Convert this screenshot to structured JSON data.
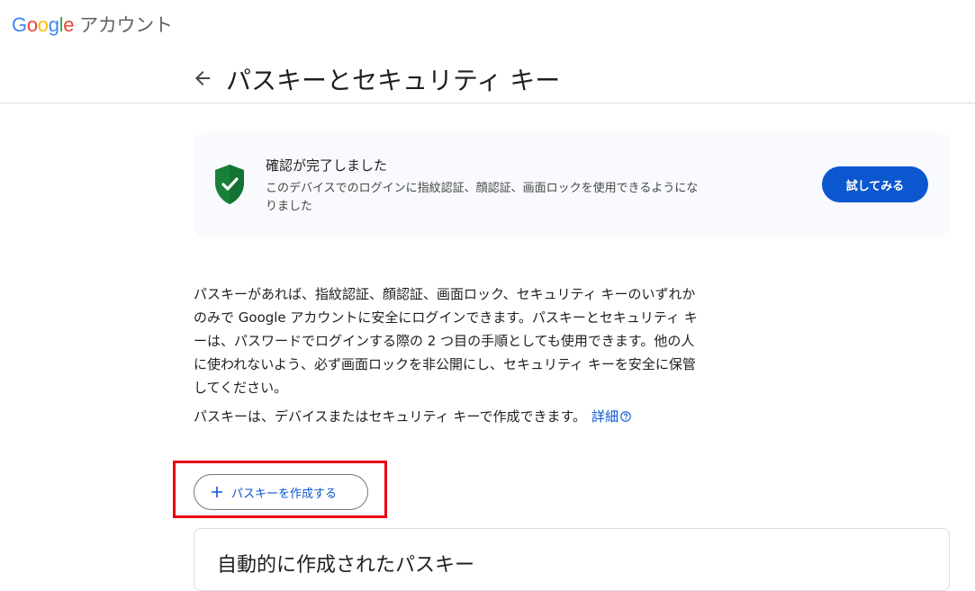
{
  "brand": {
    "logo_letters": [
      "G",
      "o",
      "o",
      "g",
      "l",
      "e"
    ],
    "product": "アカウント"
  },
  "header": {
    "title": "パスキーとセキュリティ キー"
  },
  "banner": {
    "title": "確認が完了しました",
    "description": "このデバイスでのログインに指紋認証、顔認証、画面ロックを使用できるようになりました",
    "button_label": "試してみる"
  },
  "body": {
    "paragraph1": "パスキーがあれば、指紋認証、顔認証、画面ロック、セキュリティ キーのいずれかのみで Google アカウントに安全にログインできます。パスキーとセキュリティ キーは、パスワードでログインする際の 2 つ目の手順としても使用できます。他の人に使われないよう、必ず画面ロックを非公開にし、セキュリティ キーを安全に保管してください。",
    "paragraph2": "パスキーは、デバイスまたはセキュリティ キーで作成できます。",
    "detail_link": "詳細"
  },
  "create_button": {
    "label": "パスキーを作成する"
  },
  "auto_section": {
    "title": "自動的に作成されたパスキー"
  },
  "icons": {
    "back": "back-arrow-icon",
    "shield": "shield-check-icon",
    "help": "help-circle-icon",
    "plus": "plus-icon"
  },
  "colors": {
    "accent": "#0b57d0",
    "shield_green": "#188038",
    "highlight": "#e60012",
    "banner_bg": "#f8fafd"
  }
}
